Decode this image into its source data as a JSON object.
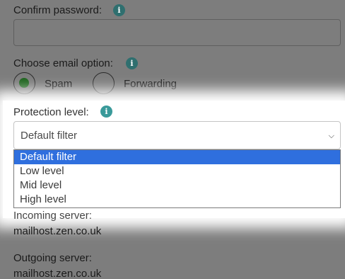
{
  "confirm_password": {
    "label": "Confirm password:",
    "value": "",
    "info_icon": "info-icon"
  },
  "email_option": {
    "label": "Choose email option:",
    "info_icon": "info-icon",
    "options": [
      {
        "label": "Spam",
        "selected": true
      },
      {
        "label": "Forwarding",
        "selected": false
      }
    ]
  },
  "protection_level": {
    "label": "Protection level:",
    "info_icon": "info-icon",
    "selected_value": "Default filter",
    "chevron_icon": "chevron-down-icon",
    "options": [
      "Default filter",
      "Low level",
      "Mid level",
      "High level"
    ],
    "highlighted_index": 0
  },
  "incoming_server": {
    "label": "Incoming server:",
    "value": "mailhost.zen.co.uk"
  },
  "outgoing_server": {
    "label": "Outgoing server:",
    "value": "mailhost.zen.co.uk"
  },
  "colors": {
    "overlay": "#7d7d7d",
    "accent_teal": "#2f6f6f",
    "radio_selected": "#1d631d",
    "option_highlight": "#2f6fde"
  }
}
